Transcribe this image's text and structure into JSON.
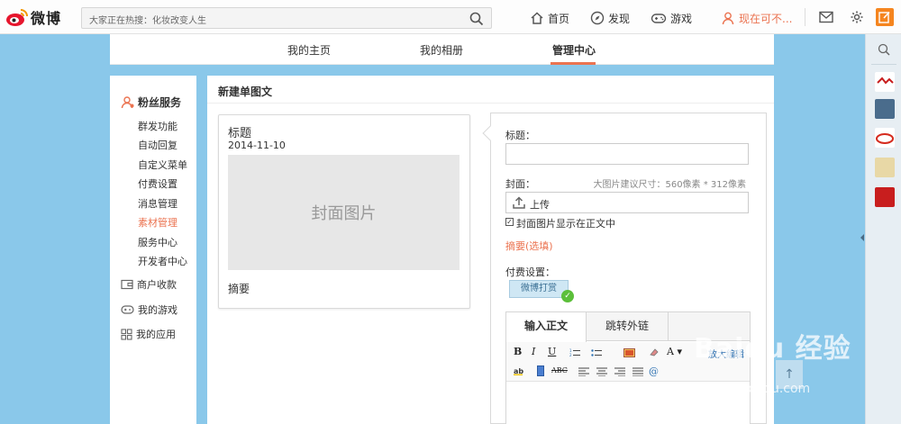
{
  "header": {
    "logo_text": "微博",
    "search_placeholder": "大家正在热搜：化妆改变人生",
    "nav": {
      "home": "首页",
      "discover": "发现",
      "games": "游戏",
      "user": "现在可不..."
    }
  },
  "profile_tabs": {
    "my_home": "我的主页",
    "my_albums": "我的相册",
    "admin_center": "管理中心",
    "active": "admin_center"
  },
  "sidebar": {
    "fans_service": "粉丝服务",
    "sub_items": [
      "群发功能",
      "自动回复",
      "自定义菜单",
      "付费设置",
      "消息管理",
      "素材管理",
      "服务中心",
      "开发者中心"
    ],
    "active_sub": "素材管理",
    "merchant": "商户收款",
    "my_games": "我的游戏",
    "my_apps": "我的应用"
  },
  "main": {
    "title": "新建单图文",
    "preview": {
      "title": "标题",
      "date": "2014-11-10",
      "cover_placeholder": "封面图片",
      "summary": "摘要"
    },
    "form": {
      "title_label": "标题：",
      "cover_label": "封面：",
      "cover_hint": "大图片建议尺寸：560像素 * 312像素",
      "upload_label": "上传",
      "show_cover_in_body": "封面图片显示在正文中",
      "show_cover_checked": true,
      "summary_link": "摘要(选填)",
      "pay_label": "付费设置：",
      "pay_badge": "微博打赏"
    },
    "editor": {
      "tab_body": "输入正文",
      "tab_link": "跳转外链",
      "enlarge": "放大编辑"
    }
  },
  "watermark": {
    "brand": "Baidu 经验",
    "url": "jingyan.baidu.com"
  },
  "colors": {
    "accent": "#eb7350",
    "page_bg": "#8ac8ea",
    "pay_badge_bg": "#cfe7f4"
  }
}
